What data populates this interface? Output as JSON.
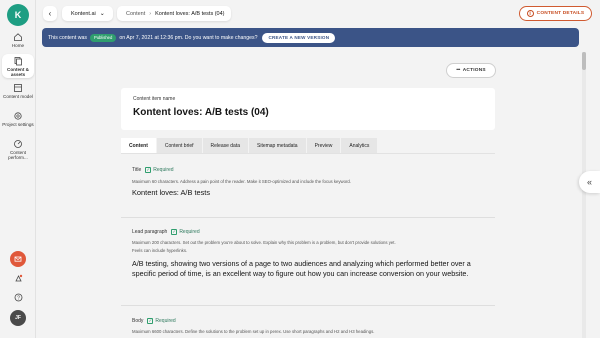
{
  "nav": {
    "logo": "K",
    "items": [
      {
        "label": "Home"
      },
      {
        "label": "Content & assets"
      },
      {
        "label": "Content model"
      },
      {
        "label": "Project settings"
      },
      {
        "label": "Content perform..."
      }
    ],
    "avatar": "JF"
  },
  "topbar": {
    "project": "Kontent.ai",
    "breadcrumb_parent": "Content",
    "breadcrumb_current": "Kontent loves: A/B tests (04)",
    "content_details": "CONTENT DETAILS"
  },
  "banner": {
    "text_before": "This content was",
    "badge": "Published",
    "text_after": "on Apr 7, 2021 at 12:36 pm. Do you want to make changes?",
    "button": "CREATE A NEW VERSION"
  },
  "actions": "ACTIONS",
  "item": {
    "name_label": "Content item name",
    "name": "Kontent loves: A/B tests (04)"
  },
  "tabs": [
    {
      "label": "Content"
    },
    {
      "label": "Content brief"
    },
    {
      "label": "Release data"
    },
    {
      "label": "Sitemap metadata"
    },
    {
      "label": "Preview"
    },
    {
      "label": "Analytics"
    }
  ],
  "fields": {
    "title": {
      "label": "Title",
      "required": "Required",
      "guide": "Maximum 60 characters. Address a pain point of the reader. Make it SEO-optimized and include the focus keyword.",
      "value": "Kontent loves: A/B tests"
    },
    "lead": {
      "label": "Lead paragraph",
      "required": "Required",
      "guide1": "Maximum 200 characters. Set out the problem you're about to solve. Explain why this problem is a problem, but don't provide solutions yet.",
      "guide2": "Feels can include hyperlinks.",
      "value1": "A/B testing, showing two versions of a page to two audiences and analyzing which performed better over a",
      "value2": "specific period of time, is an excellent way to figure out how you can increase conversion on your website."
    },
    "body": {
      "label": "Body",
      "required": "Required",
      "guide": "Maximum 6600 characters. Define the solutions to the problem set up in perex. Use short paragraphs and H2 and H3 headings."
    }
  },
  "colors": {
    "brand": "#1e9e83",
    "banner": "#3b5487",
    "accent": "#c74c20",
    "published": "#2f9e6e"
  }
}
